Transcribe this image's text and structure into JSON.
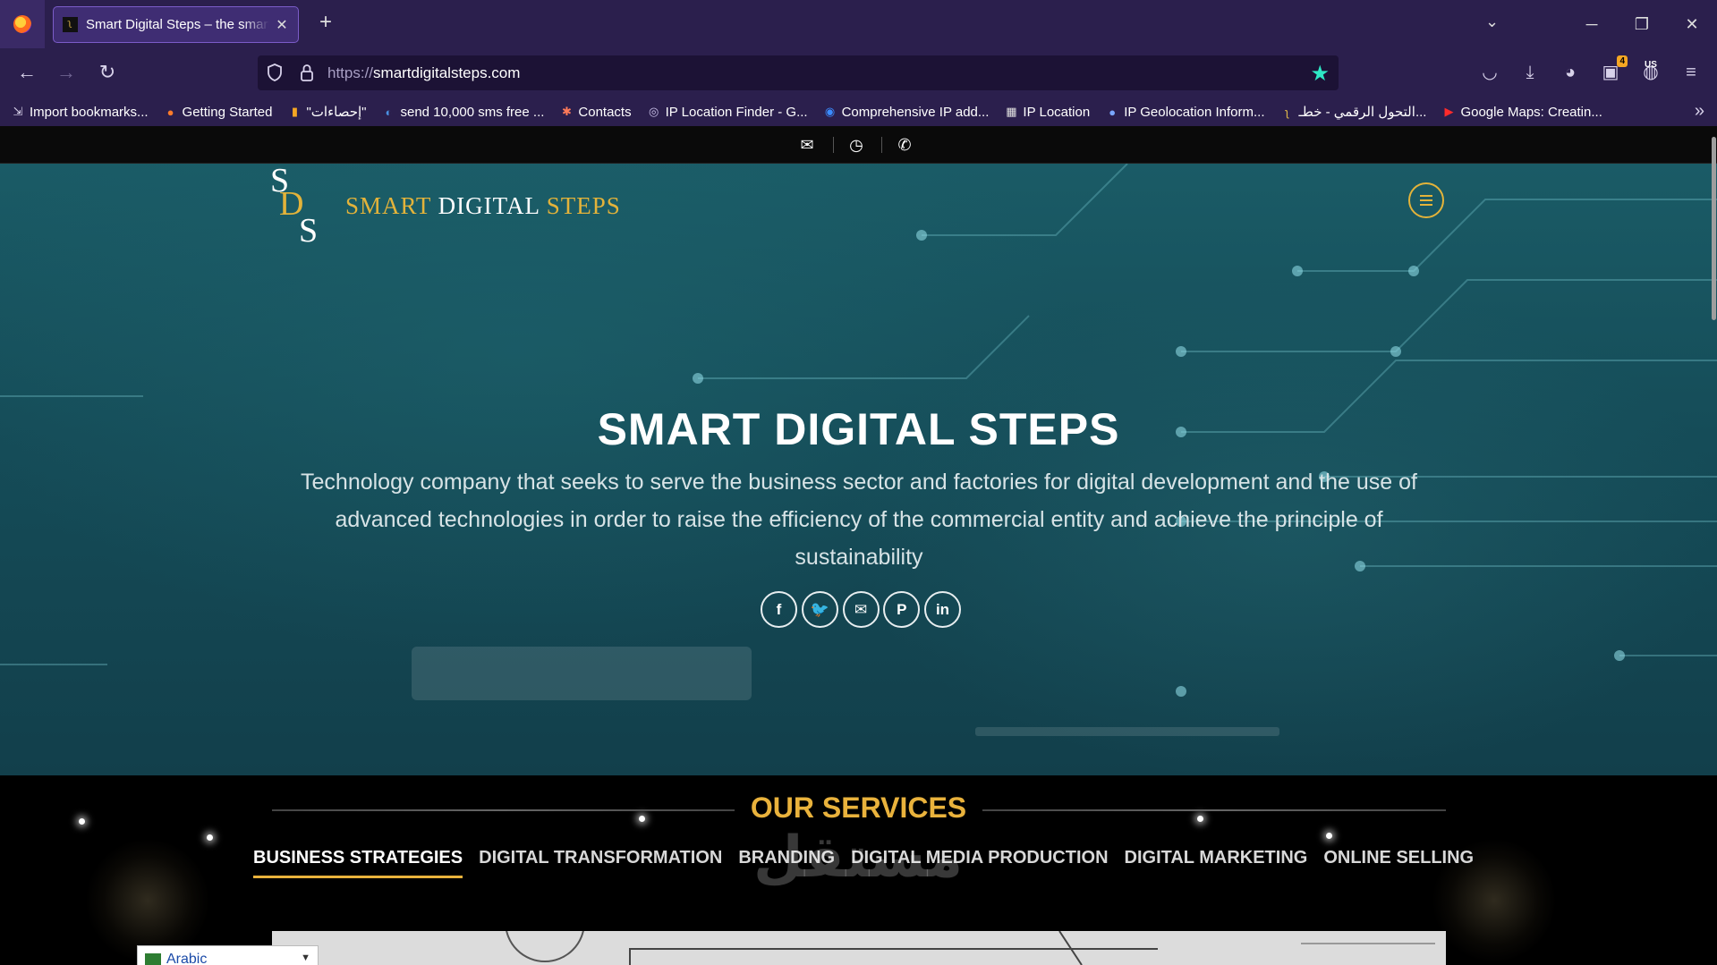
{
  "browser": {
    "tab_title": "Smart Digital Steps – the smart",
    "tab_favicon": "ʅ",
    "new_tab": "+",
    "tab_list": "⌄",
    "minimize": "─",
    "restore": "❐",
    "close": "✕",
    "url_protocol": "https://",
    "url_host": "smartdigitalsteps.com",
    "back": "←",
    "forward": "→",
    "reload": "↻",
    "extension_badge": "4",
    "locale_badge": "US",
    "bookmarks": [
      {
        "label": "Import bookmarks...",
        "icon": "import-icon",
        "glyph": "⇲",
        "color": "#d8d2ea"
      },
      {
        "label": "Getting Started",
        "icon": "firefox-icon",
        "glyph": "●",
        "color": "#ff7b2a"
      },
      {
        "label": "\"إحصاءات\"",
        "icon": "stats-icon",
        "glyph": "▮",
        "color": "#f5a623"
      },
      {
        "label": "send 10,000 sms free ...",
        "icon": "search-icon",
        "glyph": "◐",
        "color": "#4a90e2"
      },
      {
        "label": "Contacts",
        "icon": "hubspot-icon",
        "glyph": "✱",
        "color": "#ff7a59"
      },
      {
        "label": "IP Location Finder - G...",
        "icon": "globe-icon",
        "glyph": "◎",
        "color": "#c9c1e8"
      },
      {
        "label": "Comprehensive IP add...",
        "icon": "location-badge-icon",
        "glyph": "◉",
        "color": "#3a8bff"
      },
      {
        "label": "IP Location",
        "icon": "flag-icon",
        "glyph": "▦",
        "color": "#e0e0e0"
      },
      {
        "label": "IP Geolocation Inform...",
        "icon": "pin-icon",
        "glyph": "●",
        "color": "#7aa7ff"
      },
      {
        "label": "التحول الرقمي - خطـ...",
        "icon": "sds-favicon-icon",
        "glyph": "ʅ",
        "color": "#e0b84a"
      },
      {
        "label": "Google Maps: Creatin...",
        "icon": "youtube-icon",
        "glyph": "▶",
        "color": "#ff2b2b"
      }
    ],
    "bookmarks_more": "»"
  },
  "site": {
    "logo_letters": [
      "S",
      "D",
      "S"
    ],
    "logo_word1": "SMART",
    "logo_word2": "DIGITAL",
    "logo_word3": "STEPS",
    "hero_title": "SMART DIGITAL STEPS",
    "hero_subtitle": "Technology company that seeks to serve the business sector and factories for digital development and the use of advanced technologies in order to raise the efficiency of the commercial entity and achieve the principle of sustainability",
    "social_links": [
      {
        "name": "facebook-icon",
        "glyph": "f"
      },
      {
        "name": "twitter-icon",
        "glyph": "🐦"
      },
      {
        "name": "email-icon",
        "glyph": "✉"
      },
      {
        "name": "pinterest-icon",
        "glyph": "P"
      },
      {
        "name": "linkedin-icon",
        "glyph": "in"
      }
    ],
    "services_title": "OUR SERVICES",
    "service_tabs": [
      "BUSINESS STRATEGIES",
      "DIGITAL TRANSFORMATION",
      "BRANDING",
      "DIGITAL MEDIA PRODUCTION",
      "DIGITAL MARKETING",
      "ONLINE SELLING"
    ],
    "active_service_tab": 0,
    "watermark": "مستقل",
    "language": "Arabic",
    "accent_color": "#e9b23c",
    "hero_color": "#1a5b66"
  }
}
